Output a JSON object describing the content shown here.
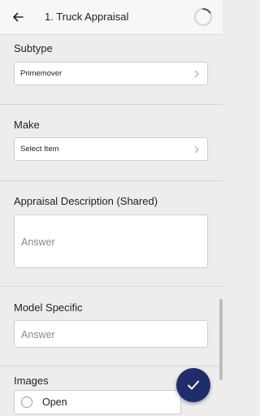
{
  "header": {
    "title": "1. Truck Appraisal"
  },
  "form": {
    "subtype": {
      "label": "Subtype",
      "value": "Primemover"
    },
    "make": {
      "label": "Make",
      "value": "Select Item"
    },
    "appraisal_description": {
      "label": "Appraisal Description (Shared)",
      "placeholder": "Answer"
    },
    "model_specific": {
      "label": "Model Specific",
      "placeholder": "Answer"
    },
    "images": {
      "label": "Images",
      "option_label": "Open"
    }
  },
  "colors": {
    "fab": "#1f2e6b",
    "background": "#ededed"
  },
  "icons": {
    "back": "arrow-left-icon",
    "progress": "progress-ring-icon",
    "chevron": "chevron-right-icon",
    "submit": "check-icon"
  }
}
